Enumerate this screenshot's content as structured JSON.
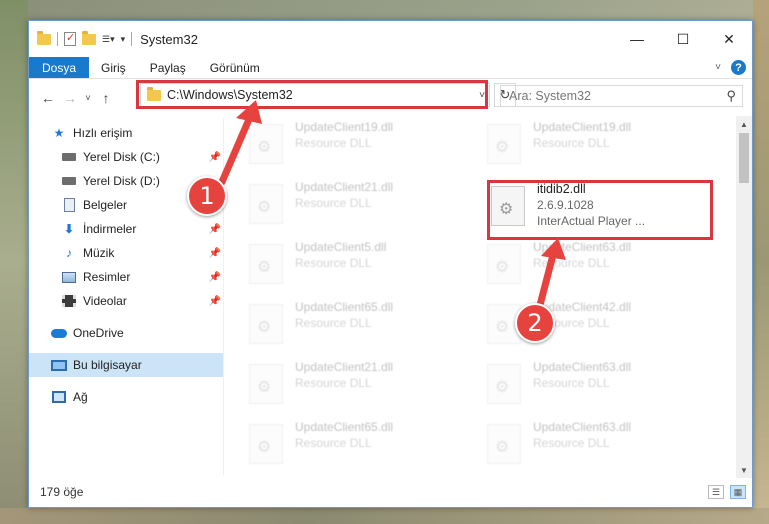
{
  "window": {
    "title": "System32"
  },
  "titlebar": {
    "minimize_glyph": "—",
    "maximize_glyph": "☐",
    "close_glyph": "✕"
  },
  "ribbon": {
    "tabs": [
      "Dosya",
      "Giriş",
      "Paylaş",
      "Görünüm"
    ],
    "help_glyph": "?"
  },
  "address": {
    "path": "C:\\Windows\\System32",
    "back_glyph": "←",
    "forward_glyph": "→",
    "recent_glyph": "˅",
    "up_glyph": "↑",
    "refresh_glyph": "↻",
    "dropdown_glyph": "˅"
  },
  "search": {
    "placeholder": "Ara: System32",
    "icon_glyph": "⚲"
  },
  "sidebar": {
    "items": [
      {
        "label": "Hızlı erişim",
        "icon": "star-icon",
        "pinned": false
      },
      {
        "label": "Yerel Disk (C:)",
        "icon": "drive-icon",
        "pinned": true
      },
      {
        "label": "Yerel Disk (D:)",
        "icon": "drive-icon",
        "pinned": false
      },
      {
        "label": "Belgeler",
        "icon": "document-icon",
        "pinned": true
      },
      {
        "label": "İndirmeler",
        "icon": "download-icon",
        "pinned": true
      },
      {
        "label": "Müzik",
        "icon": "music-icon",
        "pinned": true
      },
      {
        "label": "Resimler",
        "icon": "pictures-icon",
        "pinned": true
      },
      {
        "label": "Videolar",
        "icon": "videos-icon",
        "pinned": true
      },
      {
        "label": "OneDrive",
        "icon": "cloud-icon",
        "pinned": false
      },
      {
        "label": "Bu bilgisayar",
        "icon": "computer-icon",
        "pinned": false,
        "selected": true
      },
      {
        "label": "Ağ",
        "icon": "network-icon",
        "pinned": false
      }
    ],
    "pin_glyph": "📌"
  },
  "files": {
    "left_column": [
      {
        "name": "UpdateClient19.dll",
        "desc": "Resource DLL"
      },
      {
        "name": "UpdateClient21.dll",
        "desc": "Resource DLL"
      },
      {
        "name": "UpdateClient5.dll",
        "desc": "Resource DLL"
      },
      {
        "name": "UpdateClient65.dll",
        "desc": "Resource DLL"
      },
      {
        "name": "UpdateClient21.dll",
        "desc": "Resource DLL"
      },
      {
        "name": "UpdateClient65.dll",
        "desc": "Resource DLL"
      }
    ],
    "right_column": [
      {
        "name": "UpdateClient19.dll",
        "desc": "Resource DLL"
      },
      {
        "name": "UpdateClient63.dll",
        "desc": "Resource DLL"
      },
      {
        "name": "UpdateClient42.dll",
        "desc": "Resource DLL"
      },
      {
        "name": "UpdateClient63.dll",
        "desc": "Resource DLL"
      },
      {
        "name": "UpdateClient63.dll",
        "desc": "Resource DLL"
      }
    ],
    "highlighted": {
      "name": "itidib2.dll",
      "version": "2.6.9.1028",
      "company": "InterActual Player ..."
    }
  },
  "status": {
    "item_count": "179 öğe"
  },
  "annotations": {
    "callout_1": "1",
    "callout_2": "2"
  },
  "colors": {
    "accent": "#1979ca",
    "highlight_box": "#d9363e",
    "callout": "#e6433f",
    "selected_nav": "#cce4f7"
  }
}
